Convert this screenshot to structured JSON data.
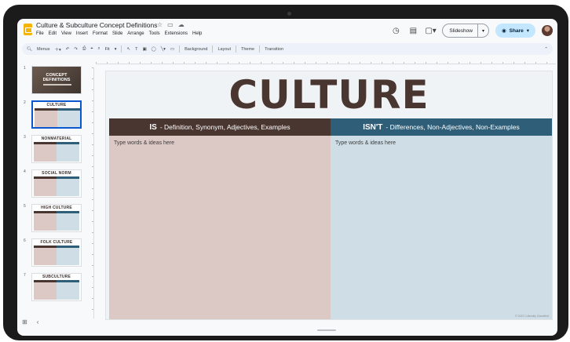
{
  "app": {
    "doc_title": "Culture & Subculture Concept Definitions",
    "title_icons": [
      "star-icon",
      "folder-move-icon",
      "cloud-saved-icon"
    ],
    "menu": [
      "File",
      "Edit",
      "View",
      "Insert",
      "Format",
      "Slide",
      "Arrange",
      "Tools",
      "Extensions",
      "Help"
    ]
  },
  "header": {
    "slideshow_label": "Slideshow",
    "share_label": "Share",
    "icons": [
      "history-icon",
      "comments-icon",
      "meet-icon"
    ]
  },
  "toolbar": {
    "search_label": "Menus",
    "zoom_label": "Fit",
    "background_label": "Background",
    "layout_label": "Layout",
    "theme_label": "Theme",
    "transition_label": "Transition"
  },
  "filmstrip": {
    "slides": [
      {
        "num": "1",
        "title": "CONCEPT DEFINITIONS"
      },
      {
        "num": "2",
        "title": "CULTURE"
      },
      {
        "num": "3",
        "title": "NONMATERIAL"
      },
      {
        "num": "4",
        "title": "SOCIAL NORM"
      },
      {
        "num": "5",
        "title": "HIGH CULTURE"
      },
      {
        "num": "6",
        "title": "FOLK CULTURE"
      },
      {
        "num": "7",
        "title": "SUBCULTURE"
      }
    ],
    "active_index": 1
  },
  "slide": {
    "title": "CULTURE",
    "is_head_bold": "IS",
    "is_head_rest": "- Definition, Synonym, Adjectives, Examples",
    "isnt_head_bold": "ISN'T",
    "isnt_head_rest": "- Differences, Non-Adjectives, Non-Examples",
    "is_placeholder": "Type words & ideas here",
    "isnt_placeholder": "Type words & ideas here",
    "credit": "© 2022 Culturally Classified"
  },
  "colors": {
    "brown": "#4a3631",
    "teal": "#2f5e78",
    "left_fill": "#dcc9c6",
    "right_fill": "#cfdde6",
    "share_bg": "#c2e7ff"
  }
}
